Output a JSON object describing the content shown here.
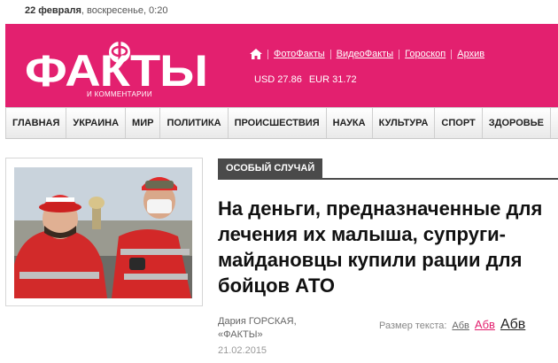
{
  "datebar": {
    "date": "22 февраля",
    "rest": ", воскресенье, 0:20"
  },
  "logo": {
    "word": "ФАКТЫ",
    "sub": "И КОММЕНТАРИИ",
    "mark": "Ф"
  },
  "topnav": [
    "ФотоФакты",
    "ВидеоФакты",
    "Гороскоп",
    "Архив"
  ],
  "rates": {
    "usd": "USD 27.86",
    "eur": "EUR 31.72"
  },
  "mainnav": [
    "ГЛАВНАЯ",
    "УКРАИНА",
    "МИР",
    "ПОЛИТИКА",
    "ПРОИСШЕСТВИЯ",
    "НАУКА",
    "КУЛЬТУРА",
    "СПОРТ",
    "ЗДОРОВЬЕ"
  ],
  "article": {
    "category": "ОСОБЫЙ СЛУЧАЙ",
    "headline": "На деньги, предназначенные для лечения их малыша, супруги-майдановцы купили рации для бойцов АТО",
    "author": "Дария ГОРСКАЯ,",
    "outlet": "«ФАКТЫ»",
    "date": "21.02.2015"
  },
  "textsize": {
    "label": "Размер текста:",
    "small": "Абв",
    "medium": "Абв",
    "large": "Абв"
  },
  "colors": {
    "brand": "#e3206f",
    "badge": "#4a4a4a"
  }
}
